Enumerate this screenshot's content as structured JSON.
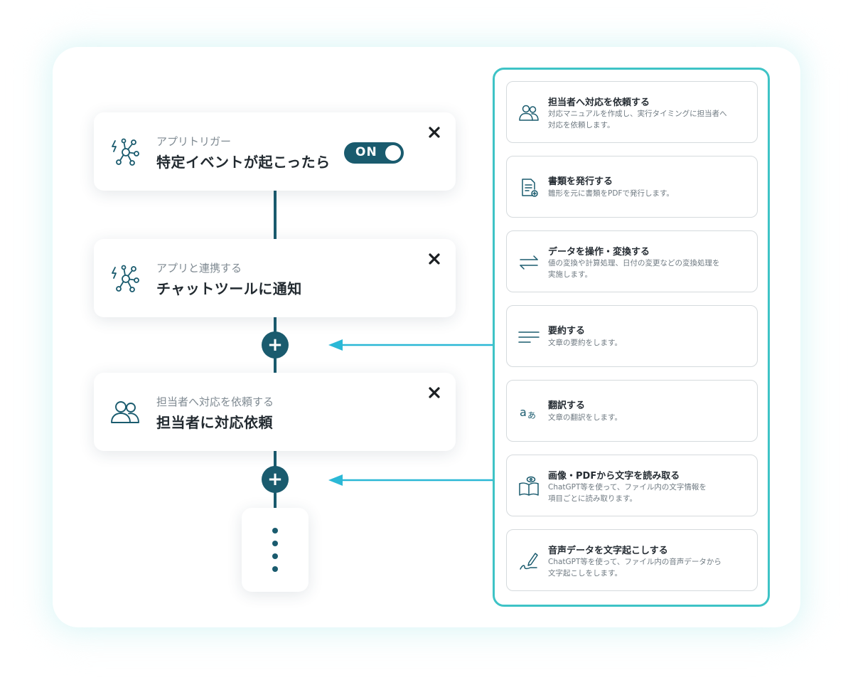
{
  "flow": {
    "trigger": {
      "subtitle": "アプリトリガー",
      "title": "特定イベントが起こったら",
      "toggle_label": "ON",
      "icon": "network-lightning-icon"
    },
    "step1": {
      "subtitle": "アプリと連携する",
      "title": "チャットツールに通知",
      "icon": "network-lightning-icon"
    },
    "step2": {
      "subtitle": "担当者へ対応を依頼する",
      "title": "担当者に対応依頼",
      "icon": "people-icon"
    },
    "add_symbol": "+"
  },
  "actions": [
    {
      "title": "担当者へ対応を依頼する",
      "desc_lines": [
        "対応マニュアルを作成し、実行タイミングに担当者へ",
        "対応を依頼します。"
      ],
      "icon": "people-icon"
    },
    {
      "title": "書類を発行する",
      "desc_lines": [
        "雛形を元に書類をPDFで発行します。"
      ],
      "icon": "document-icon"
    },
    {
      "title": "データを操作・変換する",
      "desc_lines": [
        "値の変換や計算処理、日付の変更などの変換処理を",
        "実施します。"
      ],
      "icon": "arrows-swap-icon"
    },
    {
      "title": "要約する",
      "desc_lines": [
        "文章の要約をします。"
      ],
      "icon": "lines-icon"
    },
    {
      "title": "翻訳する",
      "desc_lines": [
        "文章の翻訳をします。"
      ],
      "icon": "translate-icon"
    },
    {
      "title": "画像・PDFから文字を読み取る",
      "desc_lines": [
        "ChatGPT等を使って、ファイル内の文字情報を",
        "項目ごとに読み取ります。"
      ],
      "icon": "book-eye-icon"
    },
    {
      "title": "音声データを文字起こしする",
      "desc_lines": [
        "ChatGPT等を使って、ファイル内の音声データから",
        "文字起こしをします。"
      ],
      "icon": "pen-icon"
    }
  ],
  "colors": {
    "primary": "#1a5b6e",
    "accent": "#3ec3c6",
    "arrow": "#2bb8d6"
  }
}
